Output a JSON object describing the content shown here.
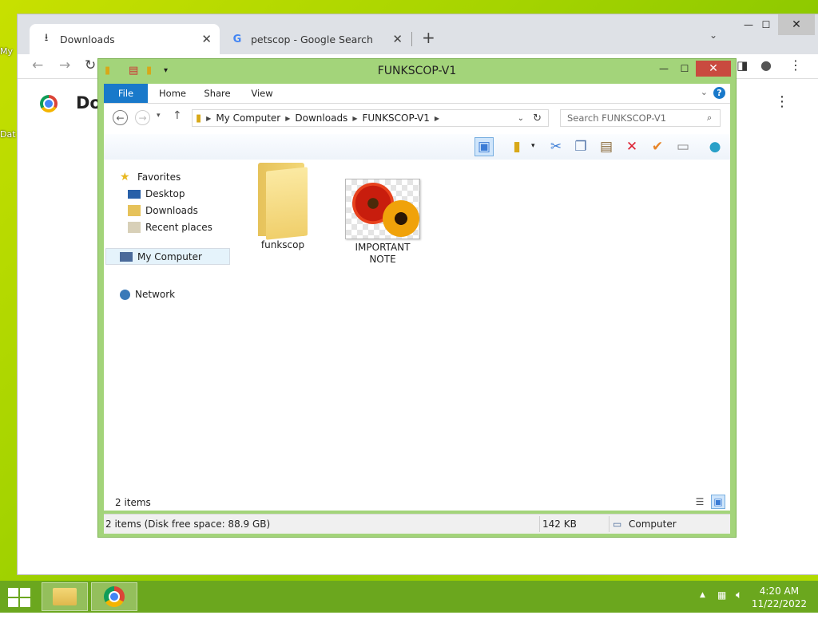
{
  "desktop": {
    "icon_fragments": [
      "My",
      "Dat"
    ]
  },
  "chrome": {
    "tabs": [
      {
        "icon": "download-icon",
        "label": "Downloads"
      },
      {
        "icon": "google-icon",
        "label": "petscop - Google Search"
      }
    ],
    "page_title": "Do"
  },
  "explorer": {
    "title": "FUNKSCOP-V1",
    "ribbon_tabs": [
      "File",
      "Home",
      "Share",
      "View"
    ],
    "breadcrumb": [
      "My Computer",
      "Downloads",
      "FUNKSCOP-V1"
    ],
    "search_placeholder": "Search FUNKSCOP-V1",
    "nav": {
      "favorites": "Favorites",
      "favorites_items": [
        "Desktop",
        "Downloads",
        "Recent places"
      ],
      "computer": "My Computer",
      "network": "Network"
    },
    "items": [
      {
        "name": "funkscop",
        "type": "folder"
      },
      {
        "name": "IMPORTANT NOTE",
        "type": "image"
      }
    ],
    "item_count": "2 items",
    "status": {
      "summary": "2 items (Disk free space: 88.9 GB)",
      "size": "142 KB",
      "location": "Computer"
    }
  },
  "taskbar": {
    "time": "4:20 AM",
    "date": "11/22/2022"
  }
}
